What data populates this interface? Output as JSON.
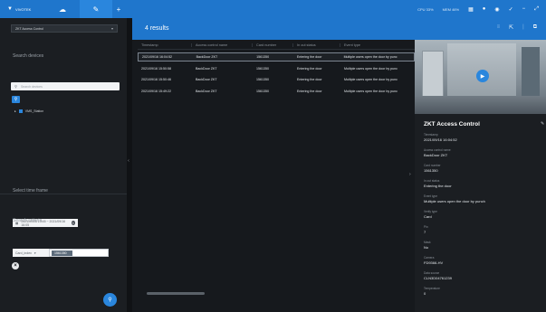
{
  "topbar": {
    "brand": "VIVOTEK",
    "tabs": [
      {
        "label": "☁",
        "icon": "cloud-icon"
      },
      {
        "label": "✎",
        "icon": "pencil-icon"
      },
      {
        "label": "+",
        "icon": "plus-icon"
      }
    ],
    "stats": {
      "cpu": "CPU 33%",
      "mem": "MEM 46%"
    },
    "accent": "#1f76cc"
  },
  "left": {
    "device_select": "ZKT Access Control",
    "search_devices_title": "Search devices",
    "search_placeholder": "Search devices",
    "tree_item": "VMS_Station",
    "time_frame_title": "Select time frame",
    "time_value": "2021/09/16 13:45 ~ 2021/09/16 16:05",
    "criteria_title": "Search criteria",
    "criteria_field": "Card_index",
    "criteria_value": "1561350"
  },
  "results": {
    "title": "4 results",
    "columns": [
      "Timestamp",
      "Access control name",
      "Card number",
      "In out status",
      "Event type"
    ],
    "rows": [
      [
        "2021/09/16 16:04:52",
        "BackDoor ZKT",
        "1561350",
        "Entering the door",
        "Multiple users open the door by punc"
      ],
      [
        "2021/09/16 15:50:58",
        "BackDoor ZKT",
        "1561350",
        "Entering the door",
        "Multiple users open the door by punc"
      ],
      [
        "2021/09/16 15:50:46",
        "BackDoor ZKT",
        "1561350",
        "Entering the door",
        "Multiple users open the door by punc"
      ],
      [
        "2021/09/16 15:49:22",
        "BackDoor ZKT",
        "1561350",
        "Entering the door",
        "Multiple users open the door by punc"
      ]
    ]
  },
  "detail": {
    "title": "ZKT Access Control",
    "fields": [
      {
        "label": "Timestamp",
        "value": "2021/09/16 16:04:52"
      },
      {
        "label": "Access control name",
        "value": "BackDoor ZKT"
      },
      {
        "label": "Card number",
        "value": "1561350"
      },
      {
        "label": "In out status",
        "value": "Entering the door"
      },
      {
        "label": "Event type",
        "value": "Multiple users open the door by punch"
      },
      {
        "label": "Verify type",
        "value": "Card"
      },
      {
        "label": "Pin",
        "value": "7"
      },
      {
        "label": "Mask",
        "value": "No"
      },
      {
        "label": "Camera",
        "value": "FD9366-HV"
      },
      {
        "label": "Data source",
        "value": "CLN3D04761239"
      },
      {
        "label": "Temperature",
        "value": "0"
      }
    ]
  }
}
